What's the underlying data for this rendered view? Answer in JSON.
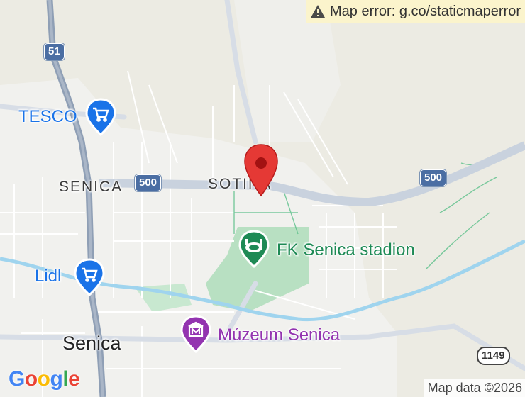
{
  "error": {
    "text": "Map error: g.co/staticmaperror",
    "icon": "warning-icon"
  },
  "labels": {
    "district_senica": "SENICA",
    "district_sotina": "SOTINA",
    "city": "Senica"
  },
  "road_shields": {
    "r51": "51",
    "r500_left": "500",
    "r500_right": "500",
    "r1149": "1149"
  },
  "pois": {
    "tesco": {
      "label": "TESCO",
      "icon": "shopping-cart-icon"
    },
    "lidl": {
      "label": "Lidl",
      "icon": "shopping-cart-icon"
    },
    "stadium": {
      "label": "FK Senica stadion",
      "icon": "stadium-icon"
    },
    "museum": {
      "label": "Múzeum Senica",
      "icon": "museum-icon"
    }
  },
  "marker": {
    "icon": "map-pin-icon"
  },
  "branding": {
    "logo": "Google"
  },
  "attribution": {
    "text": "Map data ©2026"
  },
  "colors": {
    "background": "#ecebe3",
    "highway": "#8f9fb5",
    "primary_road": "#c7d0dc",
    "water": "#9fd4ee",
    "park": "#b8e0c2",
    "poi_blue": "#1a73e8",
    "poi_green": "#1e8a55",
    "poi_purple": "#9334b0",
    "marker": "#e53935",
    "error_bg": "#fbf4cc"
  }
}
